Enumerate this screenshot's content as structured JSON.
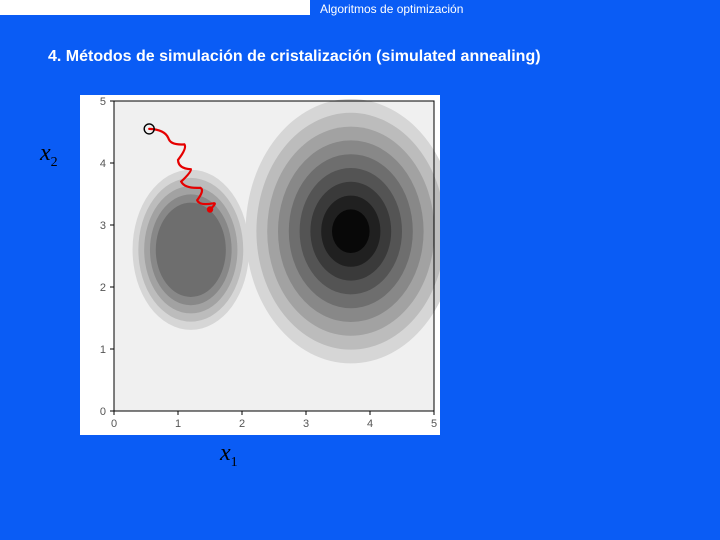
{
  "header": {
    "title": "Algoritmos de optimización"
  },
  "subtitle": "4. Métodos de simulación de cristalización (simulated annealing)",
  "axes": {
    "x": "x",
    "xsub": "1",
    "y": "x",
    "ysub": "2"
  },
  "chart_data": {
    "type": "heatmap",
    "title": "",
    "xlabel": "x1",
    "ylabel": "x2",
    "xlim": [
      0,
      5
    ],
    "ylim": [
      0,
      5
    ],
    "xticks": [
      0,
      1,
      2,
      3,
      4,
      5
    ],
    "yticks": [
      0,
      1,
      2,
      3,
      4,
      5
    ],
    "levels": [
      {
        "shade": "#f0f0f0"
      },
      {
        "shade": "#d6d6d6"
      },
      {
        "shade": "#bcbcbc"
      },
      {
        "shade": "#a2a2a2"
      },
      {
        "shade": "#888888"
      },
      {
        "shade": "#6e6e6e"
      },
      {
        "shade": "#545454"
      },
      {
        "shade": "#3a3a3a"
      },
      {
        "shade": "#202020"
      },
      {
        "shade": "#080808"
      }
    ],
    "local_min": {
      "x": 1.2,
      "y": 2.6
    },
    "global_min": {
      "x": 3.7,
      "y": 2.9
    },
    "trajectory": {
      "start": {
        "x": 0.55,
        "y": 4.55
      },
      "points": [
        {
          "x": 0.55,
          "y": 4.55
        },
        {
          "x": 0.85,
          "y": 4.4
        },
        {
          "x": 1.1,
          "y": 4.3
        },
        {
          "x": 1.0,
          "y": 4.05
        },
        {
          "x": 1.2,
          "y": 3.9
        },
        {
          "x": 1.05,
          "y": 3.7
        },
        {
          "x": 1.35,
          "y": 3.6
        },
        {
          "x": 1.3,
          "y": 3.4
        },
        {
          "x": 1.55,
          "y": 3.35
        },
        {
          "x": 1.5,
          "y": 3.25
        }
      ]
    }
  }
}
